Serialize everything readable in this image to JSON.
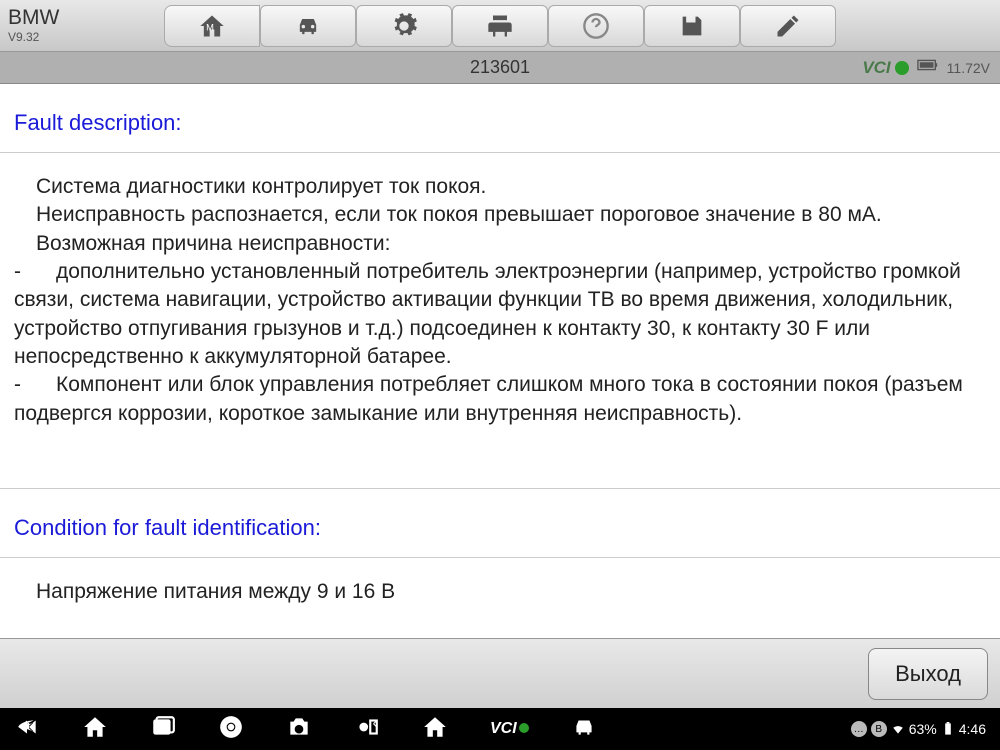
{
  "app": {
    "title": "ВMW",
    "version": "V9.32"
  },
  "status": {
    "code": "213601",
    "vci_label": "VCI",
    "voltage": "11.72V"
  },
  "content": {
    "fault_header": "Fault description:",
    "fault_line1": "Система диагностики контролирует ток покоя.",
    "fault_line2": "Неисправность распознается, если ток покоя превышает пороговое значение в 80 мА.",
    "fault_line3": "Возможная причина неисправности:",
    "fault_line4": "-      дополнительно установленный потребитель электроэнергии (например, устройство громкой связи, система навигации, устройство активации функции ТВ во время движения, холодильник, устройство отпугивания грызунов и т.д.) подсоединен к контакту 30, к контакту 30 F или непосредственно к аккумуляторной батарее.",
    "fault_line5": "-      Компонент или блок управления потребляет слишком много тока в состоянии покоя (разъем подвергся коррозии, короткое замыкание или внутренняя неисправность).",
    "condition_header": "Condition for fault identification:",
    "condition_body": "Напряжение питания между 9 и 16 В"
  },
  "footer": {
    "exit_label": "Выход"
  },
  "nav": {
    "battery_pct": "63%",
    "time": "4:46"
  }
}
